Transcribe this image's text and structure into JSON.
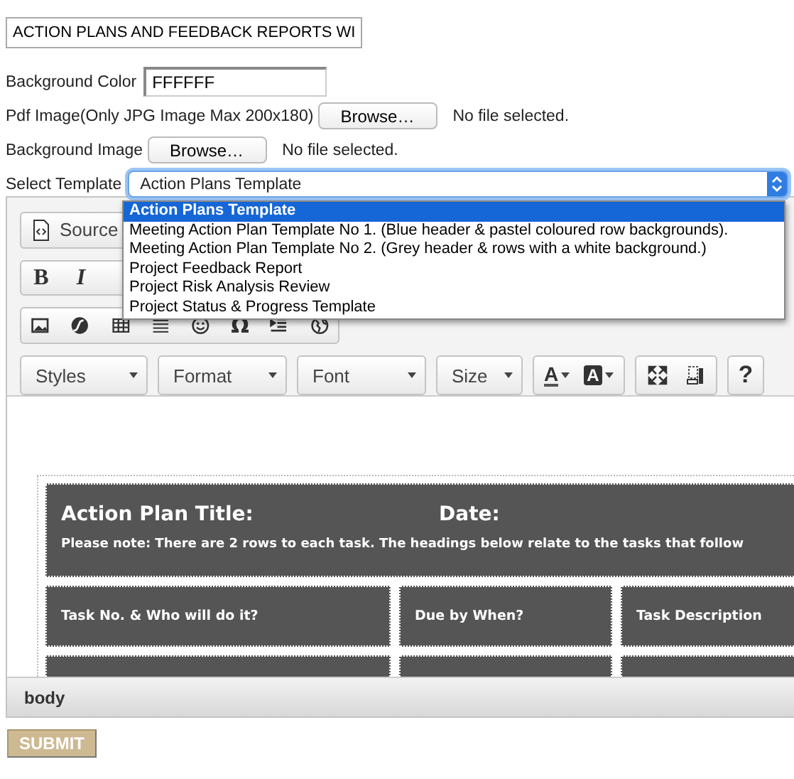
{
  "title_field": {
    "value": "ACTION PLANS AND FEEDBACK REPORTS WI"
  },
  "background_color": {
    "label": "Background Color",
    "value": "FFFFFF"
  },
  "pdf_image": {
    "label": "Pdf Image(Only JPG Image Max 200x180)",
    "button": "Browse…",
    "status": "No file selected."
  },
  "background_image": {
    "label": "Background Image",
    "button": "Browse…",
    "status": "No file selected."
  },
  "template_select": {
    "label": "Select Template",
    "value": "Action Plans Template",
    "expanded": true,
    "options": [
      {
        "label": "Action Plans Template",
        "selected": true
      },
      {
        "label": "Meeting Action Plan Template No 1. (Blue header & pastel coloured row backgrounds).",
        "selected": false
      },
      {
        "label": "Meeting Action Plan Template No 2. (Grey header & rows with a white background.)",
        "selected": false
      },
      {
        "label": "Project Feedback Report",
        "selected": false
      },
      {
        "label": "Project Risk Analysis Review",
        "selected": false
      },
      {
        "label": "Project Status & Progress Template",
        "selected": false
      }
    ]
  },
  "editor": {
    "source_button": "Source",
    "format_buttons": [
      "B",
      "I"
    ],
    "special_char_button": "Ω",
    "combos": [
      "Styles",
      "Format",
      "Font",
      "Size"
    ],
    "text_color_button": "A",
    "background_color_button": "A",
    "help_button": "?",
    "content": {
      "title": "Action Plan Title:",
      "date": "Date:",
      "note": "Please note: There are 2 rows to each task. The headings below relate to the tasks that follow",
      "headings": [
        "Task No. & Who will do it?",
        "Due by When?",
        "Task Description"
      ]
    },
    "status_bar": "body"
  },
  "submit_button": "SUBMIT"
}
